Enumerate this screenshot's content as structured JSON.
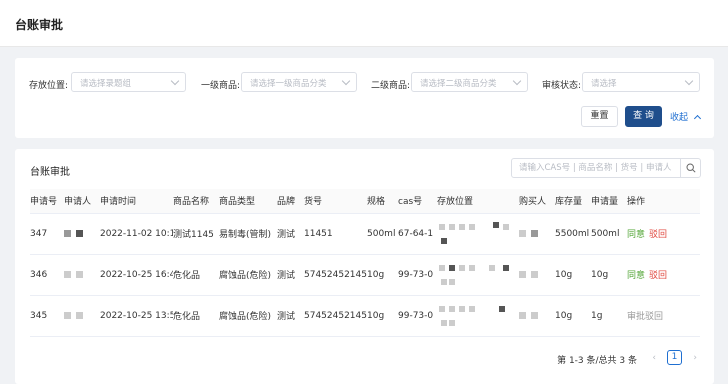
{
  "page": {
    "title": "台账审批"
  },
  "filters": [
    {
      "label": "存放位置:",
      "placeholder": "请选择录题组"
    },
    {
      "label": "一级商品:",
      "placeholder": "请选择一级商品分类"
    },
    {
      "label": "二级商品:",
      "placeholder": "请选择二级商品分类"
    },
    {
      "label": "审核状态:",
      "placeholder": "请选择"
    }
  ],
  "actions": {
    "reset": "重置",
    "query": "查 询",
    "collapse": "收起"
  },
  "table_card": {
    "title": "台账审批",
    "search_placeholder": "请输入CAS号 | 商品名称 | 货号 | 申请人",
    "columns": [
      "申请号",
      "申请人",
      "申请时间",
      "商品名称",
      "商品类型",
      "品牌",
      "货号",
      "规格",
      "cas号",
      "存放位置",
      "购买人",
      "库存量",
      "申请量",
      "操作"
    ],
    "rows": [
      {
        "id": "347",
        "time": "2022-11-02 10:15",
        "name": "测试1145",
        "type": "易制毒(管制)",
        "brand": "测试",
        "sku": "11451",
        "spec": "500ml",
        "cas": "67-64-1",
        "stock": "5500ml",
        "qty": "500ml",
        "actions": [
          "同意",
          "驳回"
        ]
      },
      {
        "id": "346",
        "time": "2022-10-25 16:44",
        "name": "危化品",
        "type": "腐蚀品(危险)",
        "brand": "测试",
        "sku": "574524521452",
        "spec": "10g",
        "cas": "99-73-0",
        "stock": "10g",
        "qty": "10g",
        "actions": [
          "同意",
          "驳回"
        ]
      },
      {
        "id": "345",
        "time": "2022-10-25 13:52",
        "name": "危化品",
        "type": "腐蚀品(危险)",
        "brand": "测试",
        "sku": "574524521452",
        "spec": "10g",
        "cas": "99-73-0",
        "stock": "10g",
        "qty": "1g",
        "actions": [
          "审批驳回"
        ]
      }
    ]
  },
  "pagination": {
    "summary": "第 1-3 条/总共 3 条",
    "current_page": "1",
    "prev": "‹",
    "next": "›"
  },
  "colors": {
    "primary": "#1f4e8c",
    "link": "#1f6fd1",
    "approve": "#52a535",
    "reject": "#e0483f"
  }
}
